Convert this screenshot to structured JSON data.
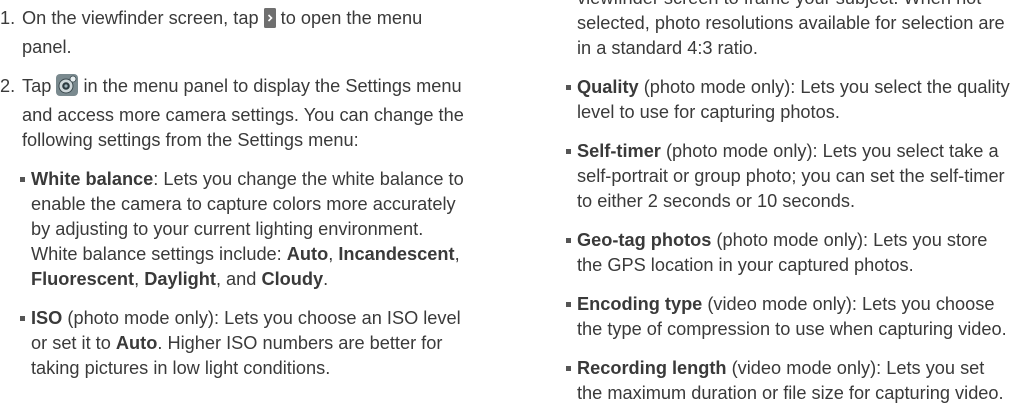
{
  "steps": [
    {
      "num": "1.",
      "before_icon": "On the viewfinder screen, tap ",
      "icon": "menu-arrow-icon",
      "after_icon": " to open the menu panel."
    },
    {
      "num": "2.",
      "before_icon": "Tap ",
      "icon": "camera-settings-icon",
      "after_icon": " in the menu panel to display the Settings menu and access more camera settings. You can change the following settings from the Settings menu:"
    }
  ],
  "left_bullets": {
    "white_balance": {
      "term": "White balance",
      "text": ": Lets you change the white balance to enable the camera to capture colors more accurately by adjusting to your current lighting environment. White balance settings include: ",
      "opt1": "Auto",
      "opt2": "Incandescent",
      "opt3": "Fluorescent",
      "opt4": "Daylight",
      "opt5": "Cloudy",
      "sep": ", ",
      "and": ", and ",
      "end": "."
    },
    "iso": {
      "term": "ISO",
      "text1": " (photo mode only): Lets you choose an ISO level or set it to ",
      "auto": "Auto",
      "text2": ". Higher ISO numbers are better for taking pictures in low light conditions."
    }
  },
  "right_partial": "viewfinder screen to frame your subject. When not selected, photo resolutions available for selection are in a standard 4:3 ratio.",
  "right_bullets": [
    {
      "term": "Quality",
      "text": " (photo mode only): Lets you select the quality level to use for capturing photos."
    },
    {
      "term": "Self-timer",
      "text": " (photo mode only): Lets you select take a self-portrait or group photo; you can set the self-timer to either 2 seconds or 10 seconds."
    },
    {
      "term": "Geo-tag photos",
      "text": " (photo mode only): Lets you store the GPS location in your captured photos."
    },
    {
      "term": "Encoding type",
      "text": " (video mode only): Lets you choose the type of compression to use when capturing video."
    },
    {
      "term": "Recording length",
      "text": " (video mode only): Lets you set the maximum duration or file size for capturing video."
    }
  ]
}
